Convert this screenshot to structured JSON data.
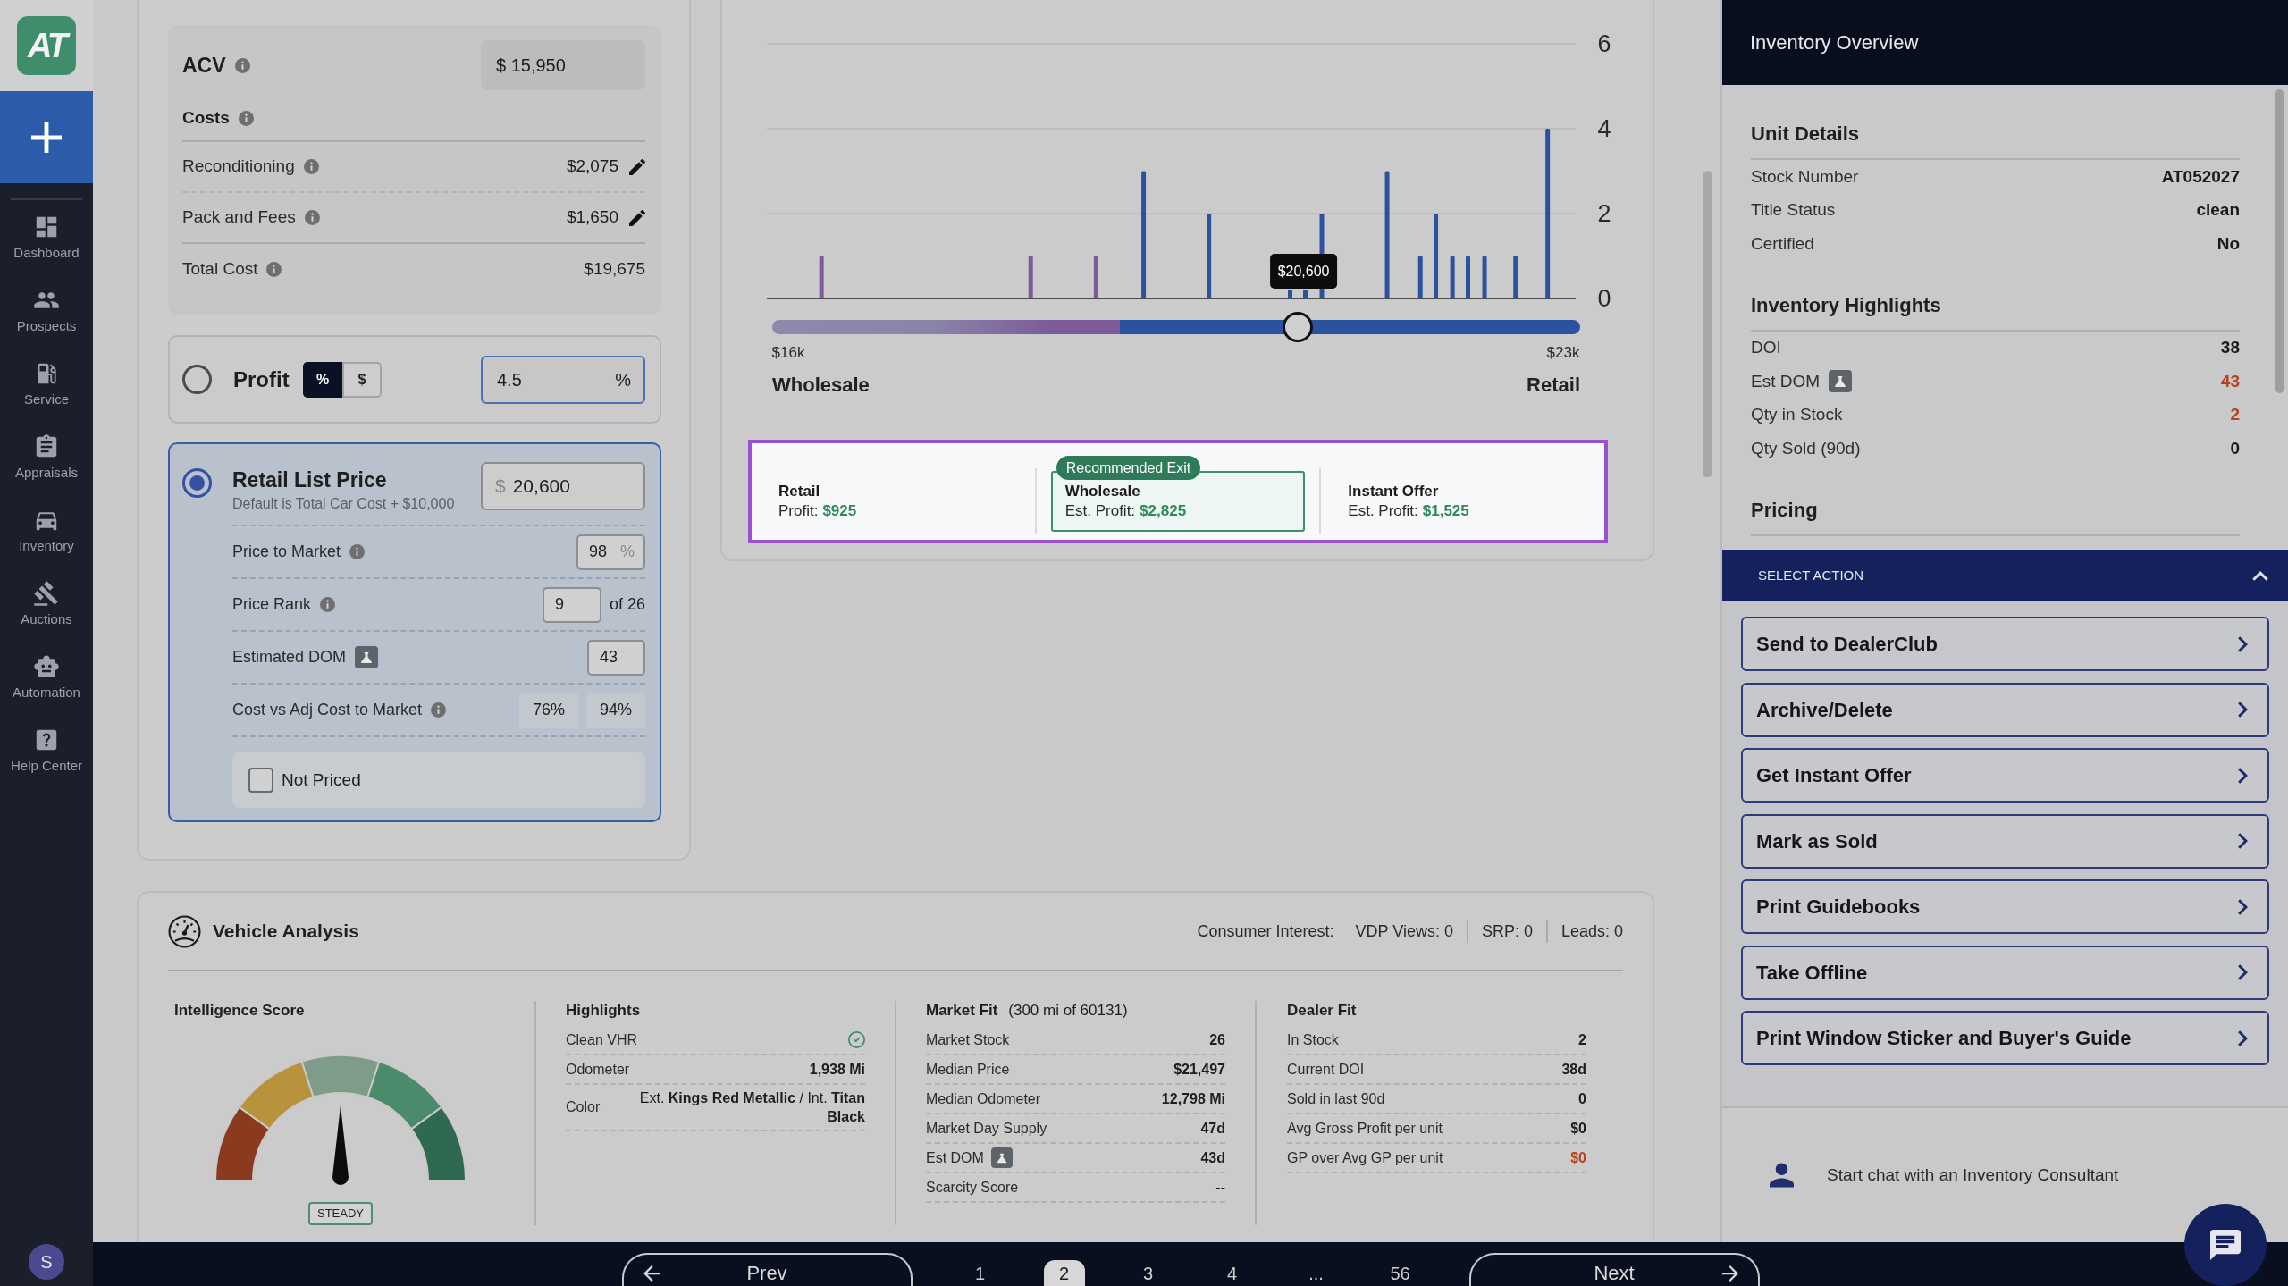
{
  "sidebar": {
    "logo": "AT",
    "items": [
      {
        "label": "Dashboard",
        "selected": false
      },
      {
        "label": "Prospects",
        "selected": false
      },
      {
        "label": "Service",
        "selected": false
      },
      {
        "label": "Appraisals",
        "selected": false
      },
      {
        "label": "Inventory",
        "selected": false
      },
      {
        "label": "Auctions",
        "selected": false
      },
      {
        "label": "Automation",
        "selected": false
      },
      {
        "label": "Help Center",
        "selected": false
      }
    ],
    "user_initial": "S"
  },
  "cost_summary": {
    "acv": {
      "label": "ACV",
      "info": true,
      "value": "$ 15,950"
    },
    "costs": {
      "label": "Costs",
      "info": true
    },
    "rows": [
      {
        "label": "Reconditioning",
        "info": true,
        "value": "$2,075",
        "editable": true
      },
      {
        "label": "Pack and Fees",
        "info": true,
        "value": "$1,650",
        "editable": true
      },
      {
        "label": "Total Cost",
        "info": true,
        "value": "$19,675",
        "editable": false
      }
    ]
  },
  "pricing_options": [
    {
      "kind": "profit",
      "label": "Profit",
      "selected": false,
      "units": [
        {
          "label": "%",
          "selected": true
        },
        {
          "label": "$",
          "selected": false
        }
      ],
      "value": "4.5",
      "suffix": "%"
    },
    {
      "kind": "list_price",
      "label": "Retail List Price",
      "selected": true,
      "hint": "Default is Total Car Cost + $10,000",
      "prefix": "$",
      "value": "20,600",
      "rows": [
        {
          "kind": "input",
          "label": "Price to Market",
          "info": true,
          "beta": false,
          "value": "98",
          "suffix": "%"
        },
        {
          "kind": "rank",
          "label": "Price Rank",
          "info": true,
          "beta": false,
          "value": "9",
          "after": "of 26"
        },
        {
          "kind": "input",
          "label": "Estimated DOM",
          "info": false,
          "beta": true,
          "value": "43"
        },
        {
          "kind": "pair",
          "label": "Cost vs Adj Cost to Market",
          "info": true,
          "beta": false,
          "values": [
            "76%",
            "94%"
          ]
        }
      ],
      "not_priced": {
        "label": "Not Priced",
        "checked": false
      }
    }
  ],
  "price_distribution": {
    "chart_data": {
      "type": "bar",
      "x": [
        16300,
        18190,
        18780,
        19210,
        19800,
        20820,
        21410,
        21710,
        21850,
        22000,
        22140,
        22290,
        22570,
        22860
      ],
      "xlim": [
        16000,
        23000
      ],
      "xticks": [
        {
          "value": 16000,
          "label": "$16k"
        },
        {
          "value": 23000,
          "label": "$23k"
        }
      ],
      "ylim": [
        0,
        6
      ],
      "yticks": [
        {
          "value": 0,
          "label": "0"
        },
        {
          "value": 2,
          "label": "2"
        },
        {
          "value": 4,
          "label": "4"
        },
        {
          "value": 6,
          "label": "6"
        }
      ],
      "stacked": true,
      "series": [
        {
          "color": "#7c5b9c",
          "values": [
            1,
            1,
            1,
            0,
            0,
            0,
            0,
            0,
            0,
            0,
            0,
            0,
            0,
            0
          ]
        },
        {
          "color": "#2a529f",
          "values": [
            0,
            0,
            0,
            3,
            2,
            2,
            3,
            1,
            2,
            1,
            1,
            1,
            1,
            4
          ]
        }
      ]
    },
    "slider": {
      "level": 0.65,
      "tooltip": "$20,600",
      "start_label": "Wholesale",
      "end_label": "Retail"
    }
  },
  "exit_options": {
    "spotlight": true,
    "items": [
      {
        "title": "Retail",
        "profit_label": "Profit:",
        "profit": "$925",
        "recommended": false
      },
      {
        "title": "Wholesale",
        "profit_label": "Est. Profit:",
        "profit": "$2,825",
        "recommended": true,
        "badge": "Recommended Exit"
      },
      {
        "title": "Instant Offer",
        "profit_label": "Est. Profit:",
        "profit": "$1,525",
        "recommended": false
      }
    ]
  },
  "vehicle_analysis": {
    "title": "Vehicle Analysis",
    "consumer_interest": {
      "label": "Consumer Interest:",
      "items": [
        "VDP Views: 0",
        "SRP: 0",
        "Leads: 0"
      ]
    },
    "intelligence_score": {
      "title": "Intelligence Score",
      "level": 0.5,
      "rating": "STEADY"
    },
    "highlights": {
      "title": "Highlights",
      "rows": [
        {
          "kind": "check",
          "label": "Clean VHR"
        },
        {
          "kind": "text",
          "label": "Odometer",
          "value": "1,938 Mi"
        },
        {
          "kind": "rich",
          "label": "Color",
          "value": "Ext. **Kings Red Metallic** / Int. **Titan Black**"
        }
      ]
    },
    "market_fit": {
      "title": "Market Fit",
      "subtitle": "(300 mi of 60131)",
      "rows": [
        {
          "kind": "text",
          "label": "Market Stock",
          "value": "26",
          "beta": false
        },
        {
          "kind": "text",
          "label": "Median Price",
          "value": "$21,497",
          "beta": false
        },
        {
          "kind": "text",
          "label": "Median Odometer",
          "value": "12,798 Mi",
          "beta": false
        },
        {
          "kind": "text",
          "label": "Market Day Supply",
          "value": "47d",
          "beta": false
        },
        {
          "kind": "text",
          "label": "Est DOM",
          "value": "43d",
          "beta": true
        },
        {
          "kind": "text",
          "label": "Scarcity Score",
          "value": "--",
          "beta": false
        }
      ]
    },
    "dealer_fit": {
      "title": "Dealer Fit",
      "rows": [
        {
          "kind": "text",
          "label": "In Stock",
          "value": "2",
          "alert": false
        },
        {
          "kind": "text",
          "label": "Current DOI",
          "value": "38d",
          "alert": false
        },
        {
          "kind": "text",
          "label": "Sold in last 90d",
          "value": "0",
          "alert": false
        },
        {
          "kind": "text",
          "label": "Avg Gross Profit per unit",
          "value": "$0",
          "alert": false
        },
        {
          "kind": "text",
          "label": "GP over Avg GP per unit",
          "value": "$0",
          "alert": true
        }
      ]
    }
  },
  "inventory_overview": {
    "title": "Inventory Overview",
    "sections": [
      {
        "title": "Unit Details",
        "rows": [
          {
            "label": "Stock Number",
            "value": "AT052027"
          },
          {
            "label": "Title Status",
            "value": "clean"
          },
          {
            "label": "Certified",
            "value": "No"
          }
        ]
      },
      {
        "title": "Inventory Highlights",
        "rows": [
          {
            "label": "DOI",
            "value": "38",
            "beta": false,
            "alert": false
          },
          {
            "label": "Est DOM",
            "value": "43",
            "beta": true,
            "alert": true
          },
          {
            "label": "Qty in Stock",
            "value": "2",
            "beta": false,
            "alert": true
          },
          {
            "label": "Qty Sold (90d)",
            "value": "0",
            "beta": false,
            "alert": false
          }
        ]
      },
      {
        "title": "Pricing"
      }
    ]
  },
  "select_action": {
    "title": "SELECT ACTION",
    "expanded": true,
    "actions": [
      "Send to DealerClub",
      "Archive/Delete",
      "Get Instant Offer",
      "Mark as Sold",
      "Print Guidebooks",
      "Take Offline",
      "Print Window Sticker and Buyer's Guide"
    ]
  },
  "chat": {
    "label": "Start chat with an Inventory Consultant"
  },
  "pagination": {
    "prev": "Prev",
    "next": "Next",
    "pages": [
      {
        "kind": "page",
        "label": "1",
        "selected": false
      },
      {
        "kind": "page",
        "label": "2",
        "selected": true
      },
      {
        "kind": "page",
        "label": "3",
        "selected": false
      },
      {
        "kind": "page",
        "label": "4",
        "selected": false
      },
      {
        "kind": "ellipsis",
        "label": "..."
      },
      {
        "kind": "page",
        "label": "56",
        "selected": false
      }
    ]
  }
}
